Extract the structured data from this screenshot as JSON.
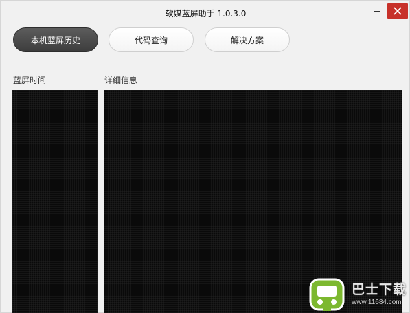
{
  "window": {
    "title": "软媒蓝屏助手 1.0.3.0"
  },
  "tabs": [
    {
      "label": "本机蓝屏历史",
      "active": true
    },
    {
      "label": "代码查询",
      "active": false
    },
    {
      "label": "解决方案",
      "active": false
    }
  ],
  "panels": {
    "time_label": "蓝屏时间",
    "detail_label": "详细信息"
  },
  "watermark": {
    "brand": "巴士下载",
    "url": "www.11684.com"
  },
  "colors": {
    "close_button": "#c7312a",
    "active_tab": "#4a4a4a",
    "panel_bg": "#0a0a0a",
    "watermark_green": "#7cb82f"
  }
}
